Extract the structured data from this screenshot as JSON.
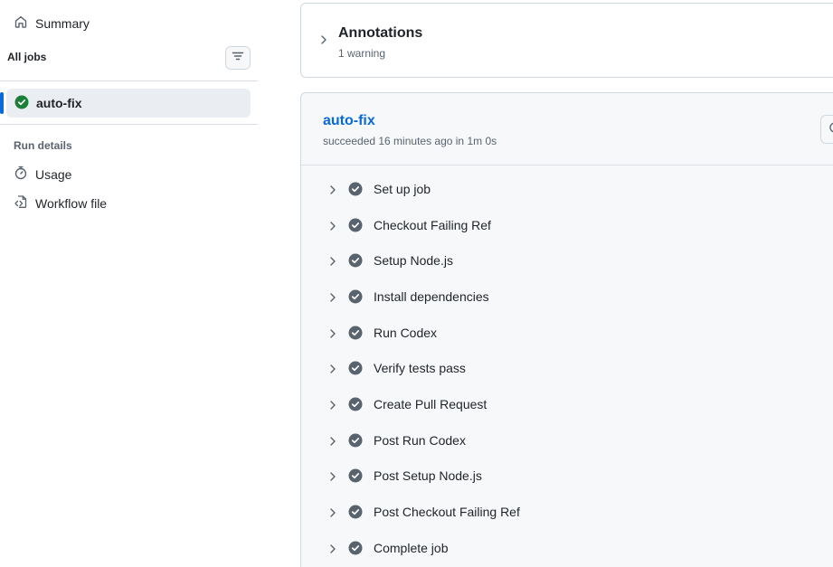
{
  "sidebar": {
    "summary_label": "Summary",
    "all_jobs_label": "All jobs",
    "jobs": [
      {
        "name": "auto-fix",
        "status": "success",
        "selected": true
      }
    ],
    "run_details_heading": "Run details",
    "details": [
      {
        "label": "Usage",
        "icon": "stopwatch-icon"
      },
      {
        "label": "Workflow file",
        "icon": "file-code-icon"
      }
    ]
  },
  "annotations": {
    "title": "Annotations",
    "subtitle": "1 warning"
  },
  "job": {
    "title": "auto-fix",
    "meta": "succeeded 16 minutes ago in 1m 0s",
    "steps": [
      "Set up job",
      "Checkout Failing Ref",
      "Setup Node.js",
      "Install dependencies",
      "Run Codex",
      "Verify tests pass",
      "Create Pull Request",
      "Post Run Codex",
      "Post Setup Node.js",
      "Post Checkout Failing Ref",
      "Complete job"
    ]
  },
  "colors": {
    "accent": "#0969da",
    "success": "#1a7f37",
    "step_check": "#59636e",
    "panel_bg": "#f6f8fa",
    "border": "#d1d9e0"
  }
}
